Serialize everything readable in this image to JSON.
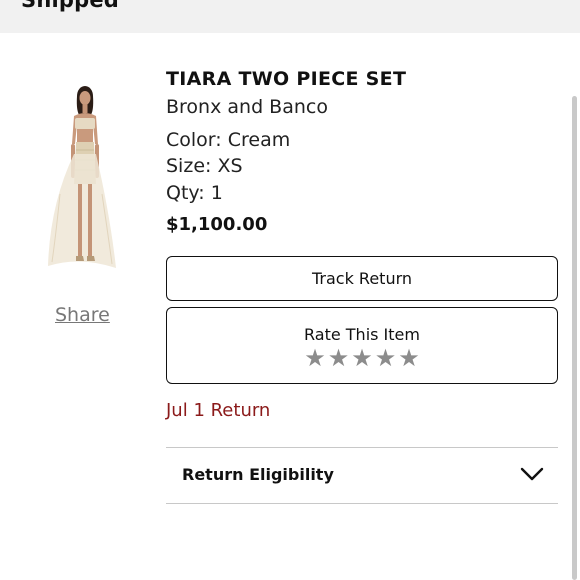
{
  "header": {
    "status": "Shipped"
  },
  "product": {
    "title": "TIARA TWO PIECE SET",
    "brand": "Bronx and Banco",
    "color": "Color: Cream",
    "size": "Size: XS",
    "qty": "Qty: 1",
    "price": "$1,100.00",
    "image_icon": "product-photo-model-in-cream-two-piece-set"
  },
  "actions": {
    "share_label": "Share",
    "track_return_label": "Track Return",
    "rate_label": "Rate This Item",
    "rating": {
      "value": 0,
      "max": 5,
      "star_glyph": "★"
    },
    "return_date": "Jul 1 Return",
    "return_eligibility_label": "Return Eligibility"
  },
  "colors": {
    "header_bg": "#f1f1f1",
    "return_date": "#8b1a1a",
    "star_empty": "#8c8c8c",
    "border": "#111111"
  }
}
